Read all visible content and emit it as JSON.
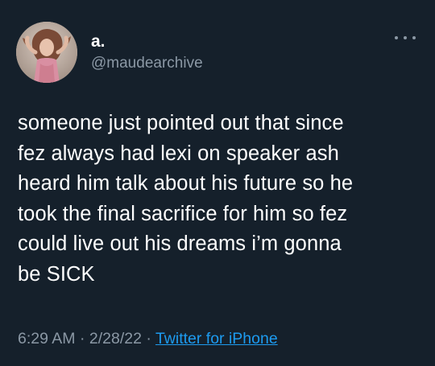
{
  "tweet": {
    "author": {
      "display_name": "a.",
      "handle": "@maudearchive",
      "avatar_icon": "profile-photo"
    },
    "more_icon": "more-options-icon",
    "text": "someone just pointed out that since\nfez always had lexi on speaker ash\nheard him talk about his future so he\ntook the final sacrifice for him so fez\ncould live out his dreams i’m gonna\nbe SICK",
    "time": "6:29 AM",
    "separator_1": " · ",
    "date": "2/28/22",
    "separator_2": " · ",
    "source": "Twitter for iPhone"
  },
  "colors": {
    "background": "#15202b",
    "primary_text": "#ffffff",
    "secondary_text": "#8b98a5",
    "link": "#1d9bf0"
  }
}
